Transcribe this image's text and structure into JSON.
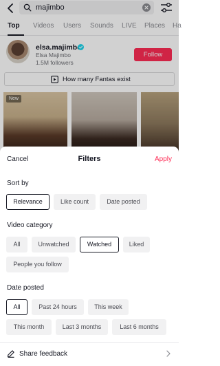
{
  "search": {
    "query": "majimbo",
    "tabs": [
      "Top",
      "Videos",
      "Users",
      "Sounds",
      "LIVE",
      "Places",
      "Ha"
    ],
    "active_tab": "Top"
  },
  "profile": {
    "username": "elsa.majimbo",
    "display_name": "Elsa Majimbo",
    "followers": "1.5M followers",
    "follow_label": "Follow"
  },
  "suggestion": {
    "text": "How many Fantas exist"
  },
  "thumbnail_badge": "New",
  "filters": {
    "cancel_label": "Cancel",
    "title": "Filters",
    "apply_label": "Apply",
    "sort_by": {
      "label": "Sort by",
      "options": [
        "Relevance",
        "Like count",
        "Date posted"
      ],
      "selected": "Relevance"
    },
    "video_category": {
      "label": "Video category",
      "options": [
        "All",
        "Unwatched",
        "Watched",
        "Liked",
        "People you follow"
      ],
      "selected": "Watched"
    },
    "date_posted": {
      "label": "Date posted",
      "options": [
        "All",
        "Past 24 hours",
        "This week",
        "This month",
        "Last 3 months",
        "Last 6 months"
      ],
      "selected": "All"
    },
    "feedback_label": "Share feedback"
  },
  "colors": {
    "accent": "#fe2c55",
    "text": "#161823",
    "chip_bg": "#f1f1f2"
  }
}
